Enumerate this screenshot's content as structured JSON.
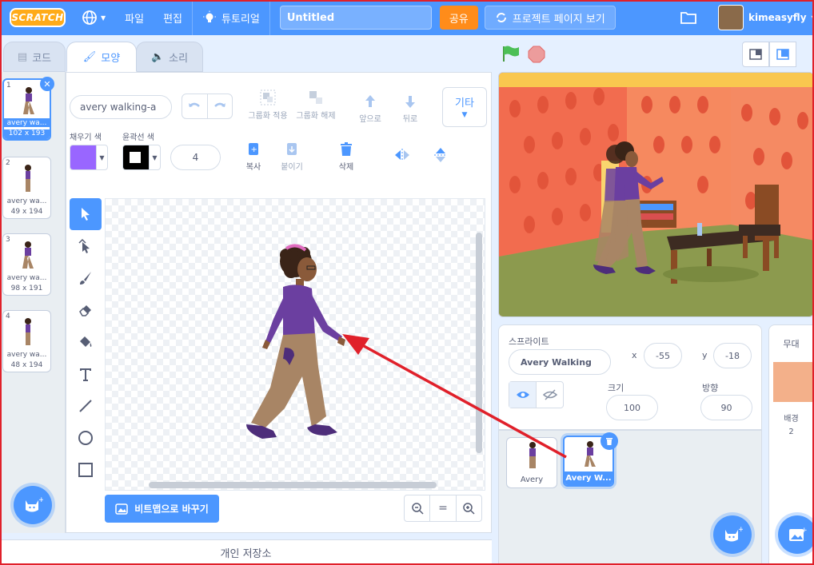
{
  "menubar": {
    "logo": "SCRATCH",
    "file": "파일",
    "edit": "편집",
    "tutorials": "튜토리얼",
    "project_title": "Untitled",
    "share": "공유",
    "see_project_page": "프로젝트 페이지 보기",
    "username": "kimeasyfly"
  },
  "tabs": {
    "code": "코드",
    "costumes": "모양",
    "sounds": "소리"
  },
  "costumes": [
    {
      "num": "1",
      "name": "avery wa...",
      "size": "102 x 193"
    },
    {
      "num": "2",
      "name": "avery wa...",
      "size": "49 x 194"
    },
    {
      "num": "3",
      "name": "avery wa...",
      "size": "98 x 191"
    },
    {
      "num": "4",
      "name": "avery wa...",
      "size": "48 x 194"
    }
  ],
  "editor": {
    "costume_name": "avery walking-a",
    "group": "그룹화 적용",
    "ungroup": "그룹화 해제",
    "forward": "앞으로",
    "backward": "뒤로",
    "more": "기타",
    "fill_label": "채우기 색",
    "outline_label": "윤곽선 색",
    "outline_width": "4",
    "copy": "복사",
    "paste": "붙이기",
    "delete": "삭제",
    "convert_bitmap": "비트맵으로 바꾸기",
    "zoom_reset": "="
  },
  "colors": {
    "fill": "#9966ff",
    "outline": "#000000",
    "accent": "#4c97ff"
  },
  "backpack": "개인 저장소",
  "sprite_info": {
    "label": "스프라이트",
    "name": "Avery Walking",
    "x_label": "x",
    "x": "-55",
    "y_label": "y",
    "y": "-18",
    "size_label": "크기",
    "size": "100",
    "direction_label": "방향",
    "direction": "90"
  },
  "sprites": [
    {
      "name": "Avery"
    },
    {
      "name": "Avery W..."
    }
  ],
  "stage_pane": {
    "title": "무대",
    "backdrops_label": "배경",
    "backdrops_count": "2"
  }
}
